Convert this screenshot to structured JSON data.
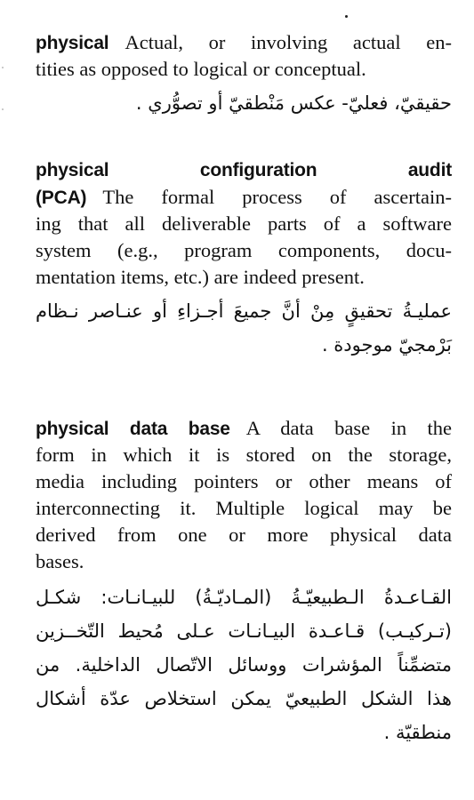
{
  "entries": [
    {
      "term": "physical",
      "definition_lines": [
        "Actual, or involving actual en-",
        "tities as opposed to logical or conceptual."
      ],
      "arabic_lines": [
        "حقيقيّ، فعليّ- عكس مَنْطقيّ أو تصوُّري ."
      ]
    },
    {
      "term_words": [
        "physical",
        "configuration",
        "audit"
      ],
      "term_line2": "(PCA)",
      "definition_lines": [
        "The formal process of ascertain-",
        "ing that all deliverable parts of a software",
        "system (e.g., program components, docu-",
        "mentation items, etc.) are indeed present."
      ],
      "arabic_lines": [
        "عمليـةُ تحقيقٍ مِنْ أنَّ جميعَ أجـزاءِ أو عنـاصر نـظام",
        "بَرْمجيّ موجودة ."
      ]
    },
    {
      "term": "physical data base",
      "definition_lines": [
        "A data base in the",
        "form in which it is stored on the storage,",
        "media including pointers or other means of",
        "interconnecting it. Multiple logical may be",
        "derived from one or more physical data",
        "bases."
      ],
      "arabic_lines": [
        "القـاعـدةُ الـطبيعيّـةُ (المـاديّـةُ) للبيـانـات: شكـل",
        "(تـركيـب) قـاعـدة البيـانـات عـلى مُحيط التّخــزين",
        "متضمِّناً المؤشرات ووسائل الاتّصال الداخلية. من",
        "هذا الشكل الطبيعيّ يمكن استخلاص عدّة أشكال",
        "منطقيّة ."
      ]
    }
  ]
}
